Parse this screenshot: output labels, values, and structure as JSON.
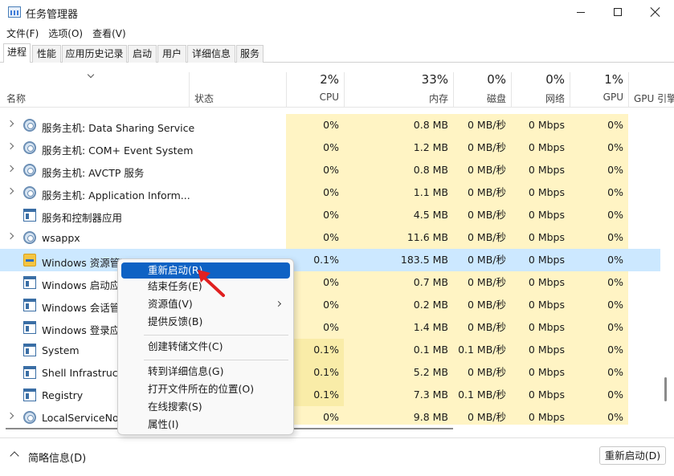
{
  "window": {
    "title": "任务管理器"
  },
  "menu": [
    "文件(F)",
    "选项(O)",
    "查看(V)"
  ],
  "tabs": [
    "进程",
    "性能",
    "应用历史记录",
    "启动",
    "用户",
    "详细信息",
    "服务"
  ],
  "header": {
    "name": "名称",
    "status": "状态",
    "cpu": {
      "pct": "2%",
      "label": "CPU"
    },
    "mem": {
      "pct": "33%",
      "label": "内存"
    },
    "disk": {
      "pct": "0%",
      "label": "磁盘"
    },
    "net": {
      "pct": "0%",
      "label": "网络"
    },
    "gpu": {
      "pct": "1%",
      "label": "GPU"
    },
    "gpu_engine": "GPU 引擎"
  },
  "rows": [
    {
      "name": "服务主机: Data Sharing Service",
      "icon": "gear-icon",
      "cpu": "0%",
      "mem": "0.8 MB",
      "disk": "0 MB/秒",
      "net": "0 Mbps",
      "gpu": "0%"
    },
    {
      "name": "服务主机: COM+ Event System",
      "icon": "gear-icon",
      "cpu": "0%",
      "mem": "1.2 MB",
      "disk": "0 MB/秒",
      "net": "0 Mbps",
      "gpu": "0%"
    },
    {
      "name": "服务主机: AVCTP 服务",
      "icon": "gear-icon",
      "cpu": "0%",
      "mem": "0.8 MB",
      "disk": "0 MB/秒",
      "net": "0 Mbps",
      "gpu": "0%"
    },
    {
      "name": "服务主机: Application Inform...",
      "icon": "gear-icon",
      "cpu": "0%",
      "mem": "1.1 MB",
      "disk": "0 MB/秒",
      "net": "0 Mbps",
      "gpu": "0%"
    },
    {
      "name": "服务和控制器应用",
      "icon": "window-icon",
      "cpu": "0%",
      "mem": "4.5 MB",
      "disk": "0 MB/秒",
      "net": "0 Mbps",
      "gpu": "0%"
    },
    {
      "name": "wsappx",
      "icon": "gear-icon",
      "cpu": "0%",
      "mem": "11.6 MB",
      "disk": "0 MB/秒",
      "net": "0 Mbps",
      "gpu": "0%"
    },
    {
      "name": "Windows 资源管理器",
      "icon": "folder-icon",
      "cpu": "0.1%",
      "mem": "183.5 MB",
      "disk": "0 MB/秒",
      "net": "0 Mbps",
      "gpu": "0%"
    },
    {
      "name": "Windows 启动应",
      "icon": "window-icon",
      "cpu": "0%",
      "mem": "0.7 MB",
      "disk": "0 MB/秒",
      "net": "0 Mbps",
      "gpu": "0%"
    },
    {
      "name": "Windows 会话管",
      "icon": "window-icon",
      "cpu": "0%",
      "mem": "0.2 MB",
      "disk": "0 MB/秒",
      "net": "0 Mbps",
      "gpu": "0%"
    },
    {
      "name": "Windows 登录应",
      "icon": "window-icon",
      "cpu": "0%",
      "mem": "1.4 MB",
      "disk": "0 MB/秒",
      "net": "0 Mbps",
      "gpu": "0%"
    },
    {
      "name": "System",
      "icon": "window-icon",
      "cpu": "0.1%",
      "mem": "0.1 MB",
      "disk": "0.1 MB/秒",
      "net": "0 Mbps",
      "gpu": "0%"
    },
    {
      "name": "Shell Infrastructu",
      "icon": "window-icon",
      "cpu": "0.1%",
      "mem": "5.2 MB",
      "disk": "0 MB/秒",
      "net": "0 Mbps",
      "gpu": "0%"
    },
    {
      "name": "Registry",
      "icon": "window-icon",
      "cpu": "0.1%",
      "mem": "7.3 MB",
      "disk": "0.1 MB/秒",
      "net": "0 Mbps",
      "gpu": "0%"
    },
    {
      "name": "LocalServiceNoN",
      "icon": "gear-icon",
      "cpu": "0%",
      "mem": "9.8 MB",
      "disk": "0 MB/秒",
      "net": "0 Mbps",
      "gpu": "0%"
    }
  ],
  "context_menu": {
    "restart": "重新启动(R)",
    "end_task": "结束任务(E)",
    "resource_values": "资源值(V)",
    "feedback": "提供反馈(B)",
    "create_dump": "创建转储文件(C)",
    "go_details": "转到详细信息(G)",
    "open_location": "打开文件所在的位置(O)",
    "search_online": "在线搜索(S)",
    "properties": "属性(I)"
  },
  "footer": {
    "summary": "简略信息(D)",
    "restart_button": "重新启动(D)"
  },
  "colors": {
    "selection": "#cce8ff",
    "menu_highlight": "#0e62c4",
    "heat_light": "#fff4c4",
    "heat_mid": "#f9eca8",
    "arrow": "#e02020"
  }
}
